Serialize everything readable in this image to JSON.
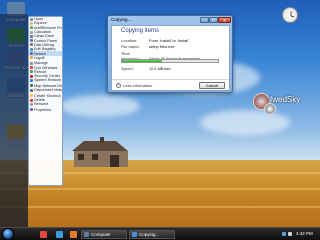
{
  "desktop": {
    "icons": [
      {
        "label": "Computer",
        "color": "#5c7fa6"
      },
      {
        "label": "Games",
        "color": "#2f8f3a"
      },
      {
        "label": "Recycle Bin",
        "color": "#4a6fb8"
      },
      {
        "label": "Network",
        "color": "#3c7bc8"
      },
      {
        "label": "Files",
        "color": "#e0b34a"
      }
    ],
    "sky_label": "IwedSky"
  },
  "start_menu": {
    "items": [
      {
        "label": "Open",
        "color": "#6b8fc4"
      },
      {
        "label": "Explore",
        "color": "#e0b34a"
      },
      {
        "label": "Add/Remove Programs",
        "color": "#4caf50"
      },
      {
        "label": "Calculator",
        "color": "#9e9e9e"
      },
      {
        "label": "Clean Drive",
        "color": "#607d8b"
      },
      {
        "label": "Control Panel",
        "color": "#3f7cc9"
      },
      {
        "label": "Disk Defrag",
        "color": "#8d6e63"
      },
      {
        "label": "Edit Registry",
        "color": "#4a90d9"
      },
      {
        "label": "Search",
        "color": "#5c6bc0"
      },
      {
        "label": "Logoff",
        "color": "#f5a623"
      },
      {
        "label": "Manage",
        "color": "#78909c"
      },
      {
        "label": "Quit Windows",
        "color": "#e53935"
      },
      {
        "label": "Reboot",
        "color": "#43a047"
      },
      {
        "label": "Security Center",
        "color": "#c62828"
      },
      {
        "label": "System Restore",
        "color": "#1e88e5"
      },
      {
        "label": "Map Network Drive",
        "color": "#546e7a"
      },
      {
        "label": "Disconnect Network Drive",
        "color": "#546e7a"
      },
      {
        "label": "Create Shortcut",
        "color": "#fbc02d"
      },
      {
        "label": "Delete",
        "color": "#e53935"
      },
      {
        "label": "Rename",
        "color": "#90a4ae"
      },
      {
        "label": "Properties",
        "color": "#7e57c2"
      }
    ],
    "selected_index": 8
  },
  "dialog": {
    "title": "Copying...",
    "heading": "Copying items",
    "location_label": "Location:",
    "location_value": "From 'Install' to 'Install'",
    "filename_label": "File name:",
    "filename_value": "setup files.exe",
    "time_label": "Time remaining:",
    "time_value": "About 40 Seconds remaining",
    "speed_label": "Speed:",
    "speed_value": "11.4 MB/sec",
    "progress_fraction": 0.42,
    "less_info": "Less information",
    "cancel": "Cancel",
    "minimize": "–",
    "maximize": "□",
    "close": "x"
  },
  "taskbar": {
    "tasks": [
      {
        "label": "Computer",
        "color": "#5c7fa6"
      },
      {
        "label": "Copying...",
        "color": "#4a90d9"
      }
    ],
    "quick_launch": [
      "#e04a3a",
      "#3f9be0",
      "#e07a2e"
    ],
    "time": "4:42 PM"
  }
}
